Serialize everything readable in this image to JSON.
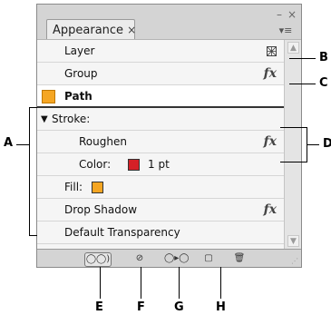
{
  "panel": {
    "tab_label": "Appearance",
    "tab_close": "×",
    "minimize": "–",
    "close": "×",
    "menu": "▾≡"
  },
  "rows": {
    "layer": "Layer",
    "group": "Group",
    "path": "Path",
    "stroke": "Stroke:",
    "stroke_toggle": "▼",
    "roughen": "Roughen",
    "color_label": "Color:",
    "stroke_weight": "1 pt",
    "fill": "Fill:",
    "drop_shadow": "Drop Shadow",
    "default_transparency": "Default Transparency",
    "fx": "fx"
  },
  "colors": {
    "stroke_color": "#d42027",
    "fill_color": "#f5a623",
    "path_thumb": "#f5a623"
  },
  "toolbar": {
    "add_new_effect": "◯◯)",
    "clear_appearance": "⊘",
    "reduce_to_basic": "◯▸◯",
    "duplicate_item": "▢",
    "delete_item": "🗑"
  },
  "callouts": {
    "A": "A",
    "B": "B",
    "C": "C",
    "D": "D",
    "E": "E",
    "F": "F",
    "G": "G",
    "H": "H"
  }
}
